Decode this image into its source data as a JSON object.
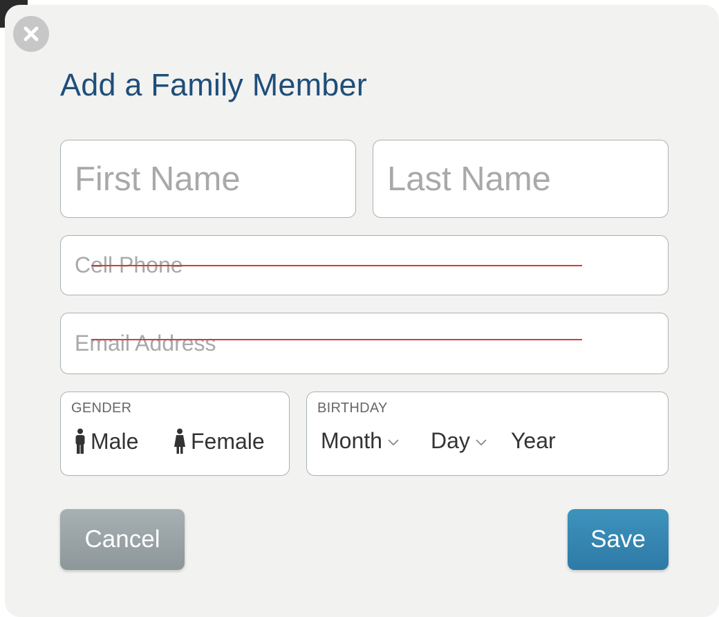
{
  "dialog": {
    "title": "Add a Family Member",
    "close_icon": "close-icon"
  },
  "form": {
    "first_name": {
      "placeholder": "First Name",
      "value": ""
    },
    "last_name": {
      "placeholder": "Last Name",
      "value": ""
    },
    "cell_phone": {
      "placeholder": "Cell Phone",
      "value": "",
      "struck_through": true
    },
    "email": {
      "placeholder": "Email Address",
      "value": "",
      "struck_through": true
    },
    "gender": {
      "label": "GENDER",
      "options": [
        {
          "label": "Male",
          "icon": "male-icon"
        },
        {
          "label": "Female",
          "icon": "female-icon"
        }
      ]
    },
    "birthday": {
      "label": "BIRTHDAY",
      "month": "Month",
      "day": "Day",
      "year": "Year"
    }
  },
  "buttons": {
    "cancel": "Cancel",
    "save": "Save"
  },
  "colors": {
    "title": "#1f4e79",
    "dialog_bg": "#f2f2f1",
    "save_button": "#3787b2",
    "cancel_button": "#9aa4a6",
    "strike_line": "#d43a3a"
  }
}
